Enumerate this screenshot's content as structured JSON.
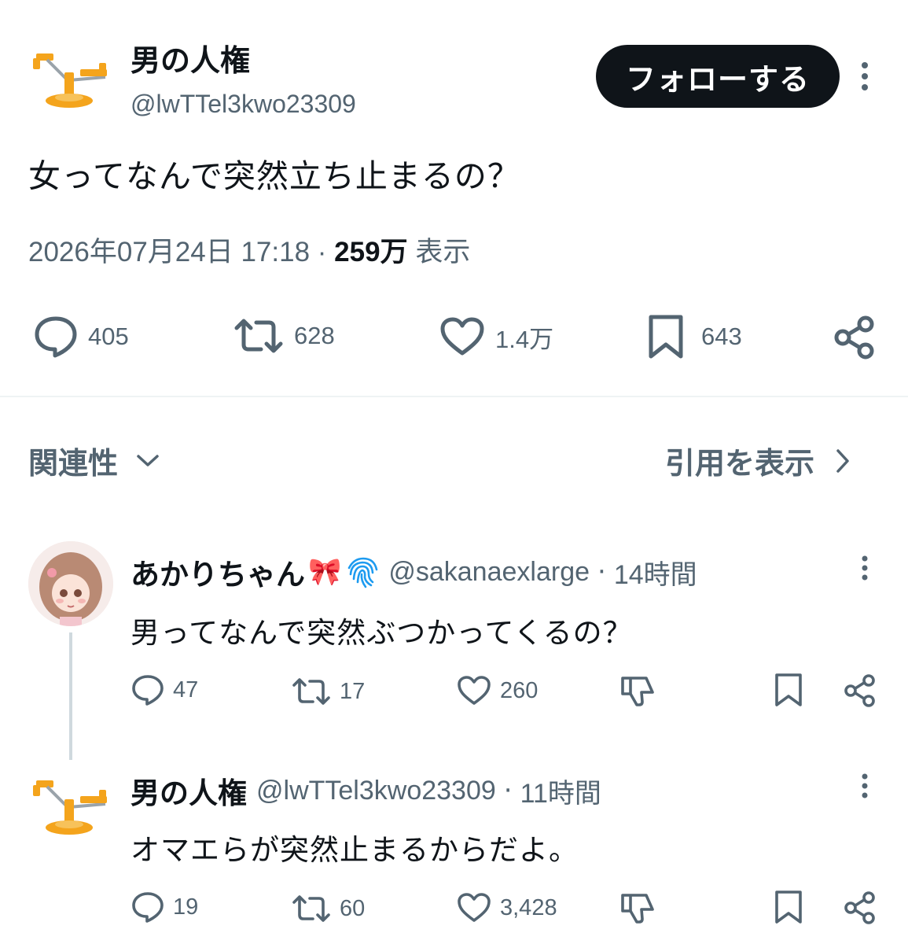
{
  "main_tweet": {
    "display_name": "男の人権",
    "handle": "@lwTTel3kwo23309",
    "follow_label": "フォローする",
    "text": "女ってなんで突然立ち止まるの？",
    "timestamp": "2026年07月24日 17:18",
    "separator": "·",
    "views_count": "259万",
    "views_label": "表示",
    "stats": {
      "replies": "405",
      "retweets": "628",
      "likes": "1.4万",
      "bookmarks": "643"
    }
  },
  "sort_bar": {
    "sort_label": "関連性",
    "quotes_label": "引用を表示"
  },
  "replies": [
    {
      "display_name": "あかりちゃん",
      "emoji": "🎀",
      "handle": "@sakanaexlarge",
      "separator": "·",
      "time": "14時間",
      "text": "男ってなんで突然ぶつかってくるの？",
      "stats": {
        "replies": "47",
        "retweets": "17",
        "likes": "260"
      }
    },
    {
      "display_name": "男の人権",
      "handle": "@lwTTel3kwo23309",
      "separator": "·",
      "time": "11時間",
      "text": "オマエらが突然止まるからだよ。",
      "stats": {
        "replies": "19",
        "retweets": "60",
        "likes": "3,428"
      }
    }
  ],
  "colors": {
    "text": "#0f1419",
    "muted": "#536471",
    "divider": "#eff3f4",
    "thread_line": "#cfd9de",
    "logo_orange": "#f4a41c",
    "logo_gray": "#c8ced3",
    "verified_blue": "#1d9bf0"
  },
  "icons": [
    "scale-logo-icon",
    "more-icon",
    "reply-icon",
    "retweet-icon",
    "like-icon",
    "bookmark-icon",
    "share-icon",
    "chevron-down-icon",
    "chevron-right-icon",
    "dislike-icon",
    "fingerprint-badge-icon"
  ]
}
